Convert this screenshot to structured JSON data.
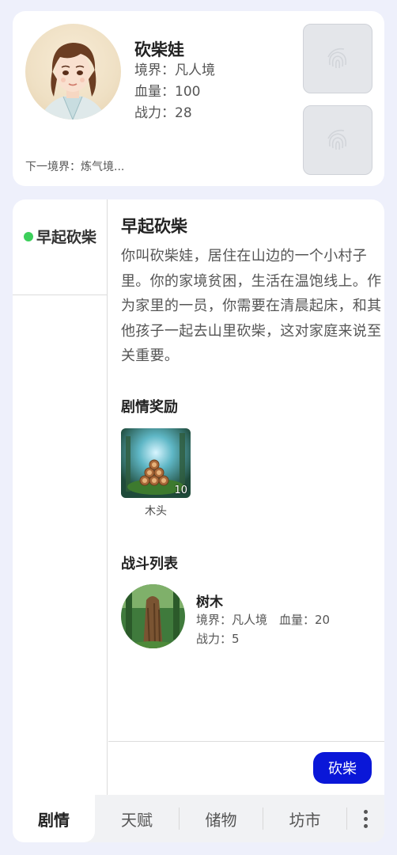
{
  "player": {
    "name": "砍柴娃",
    "realm_line": "境界：凡人境",
    "hp_line": "血量：100",
    "power_line": "战力：28",
    "next_realm": "下一境界：炼气境..."
  },
  "chapter": {
    "label": "早起砍柴",
    "status_color": "#3ccf5b"
  },
  "story": {
    "title": "早起砍柴",
    "text": "你叫砍柴娃，居住在山边的一个小村子里。你的家境贫困，生活在温饱线上。作为家里的一员，你需要在清晨起床，和其他孩子一起去山里砍柴，这对家庭来说至关重要。"
  },
  "rewards": {
    "section_title": "剧情奖励",
    "items": [
      {
        "name": "木头",
        "quantity": "10"
      }
    ]
  },
  "battle": {
    "section_title": "战斗列表",
    "enemies": [
      {
        "name": "树木",
        "realm_hp": "境界：凡人境　血量：20",
        "power": "战力：5"
      }
    ]
  },
  "action": {
    "button_label": "砍柴",
    "color": "#0a17d8"
  },
  "nav": {
    "tabs": [
      "剧情",
      "天赋",
      "储物",
      "坊市"
    ],
    "active_index": 0
  }
}
